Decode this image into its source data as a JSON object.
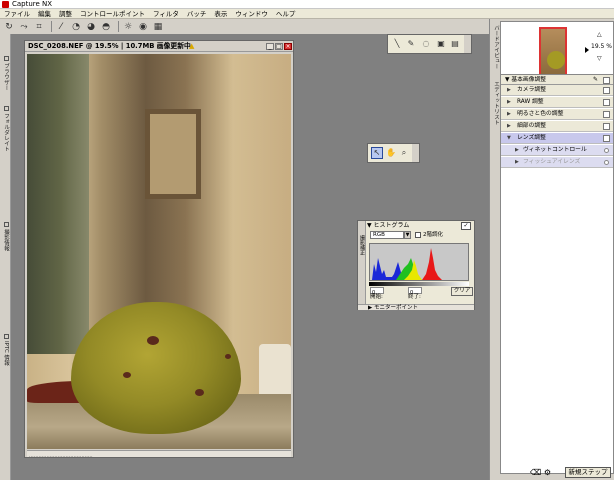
{
  "app": {
    "title": "Capture NX"
  },
  "menu": [
    "ファイル",
    "編集",
    "調整",
    "コントロールポイント",
    "フィルタ",
    "バッチ",
    "表示",
    "ウィンドウ",
    "ヘルプ"
  ],
  "left_tabs": [
    "ブラウザー",
    "フォルダレイト",
    "撮影情報",
    "IPTC 情報"
  ],
  "document": {
    "title": "DSC_0208.NEF @ 19.5% | 10.7MB 画像更新中",
    "status": "........................................"
  },
  "histogram": {
    "title": "ヒストグラム",
    "channel": "RGB",
    "option_label": "2階調化",
    "start_label": "開始:",
    "end_label": "終了:",
    "start_value": "0",
    "end_value": "0",
    "clear_button": "クリア",
    "side_label": "撮影補正",
    "footer": "モニターポイント"
  },
  "birdseye": {
    "tab": "バードアイビュー",
    "zoom": "19.5 %"
  },
  "edit_list": {
    "tab": "エディットリスト",
    "title": "基本画像調整",
    "items": [
      {
        "label": "カメラ調整"
      },
      {
        "label": "RAW 調整"
      },
      {
        "label": "明るさと色の調整"
      },
      {
        "label": "細部の調整"
      },
      {
        "label": "レンズ調整"
      },
      {
        "label": "ヴィネットコントロール"
      },
      {
        "label": "フィッシュアイレンズ"
      }
    ]
  },
  "new_step": "新規ステップ",
  "colors": {
    "titlebar_bg": "#ffffff",
    "workspace_bg": "#808080",
    "panel_bg": "#d4d0c8",
    "highlight": "#c8c8ec"
  }
}
